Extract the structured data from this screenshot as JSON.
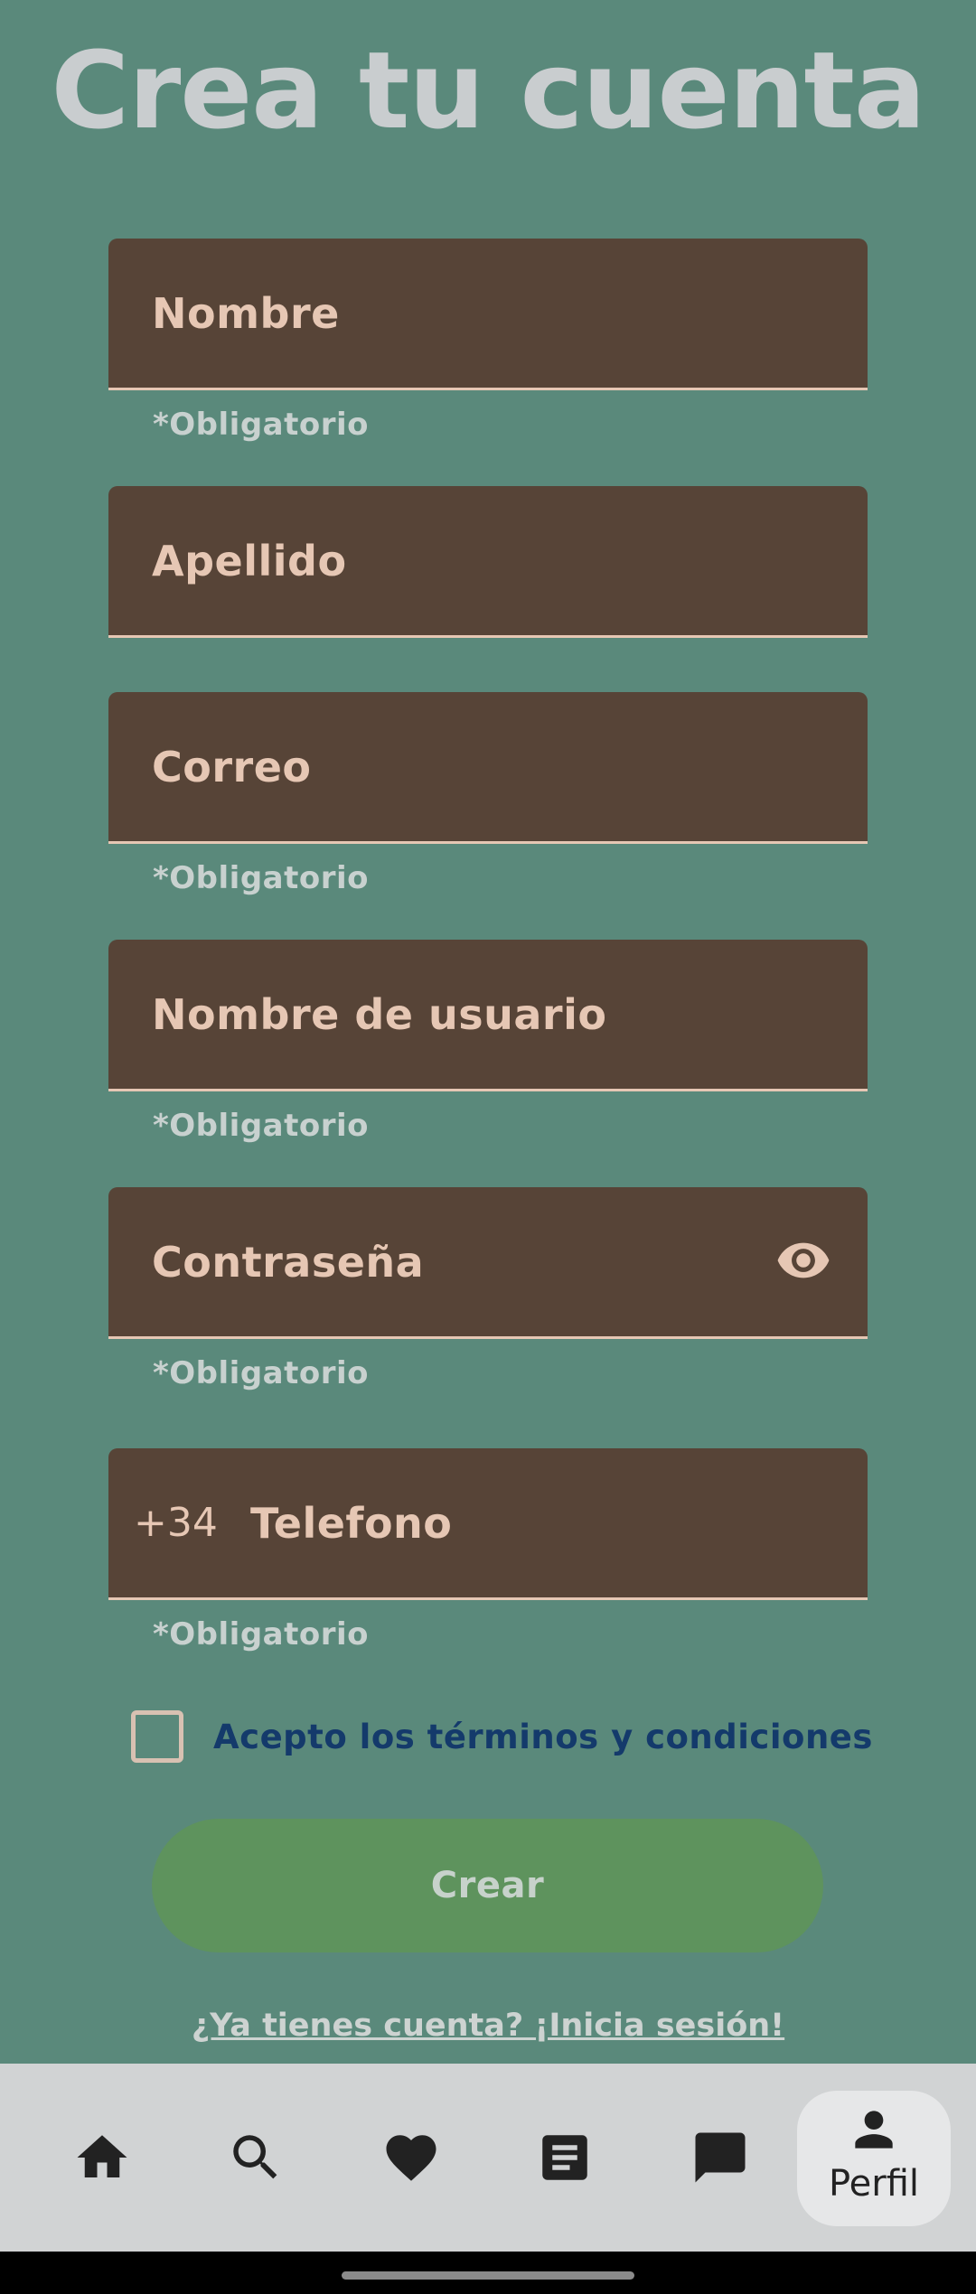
{
  "header": {
    "title": "Crea tu cuenta"
  },
  "form": {
    "nombre": {
      "label": "Nombre",
      "helper": "*Obligatorio"
    },
    "apellido": {
      "label": "Apellido"
    },
    "correo": {
      "label": "Correo",
      "helper": "*Obligatorio"
    },
    "usuario": {
      "label": "Nombre de usuario",
      "helper": "*Obligatorio"
    },
    "contrasena": {
      "label": "Contraseña",
      "helper": "*Obligatorio",
      "icon": "eye-icon"
    },
    "telefono": {
      "prefix": "+34",
      "label": "Telefono",
      "helper": "*Obligatorio"
    },
    "terms_label": "Acepto los términos y condiciones",
    "create_label": "Crear",
    "login_link": "¿Ya tienes cuenta? ¡Inicia sesión!"
  },
  "nav": {
    "items": [
      {
        "icon": "home-icon"
      },
      {
        "icon": "search-icon"
      },
      {
        "icon": "heart-icon"
      },
      {
        "icon": "document-icon"
      },
      {
        "icon": "chat-icon"
      },
      {
        "icon": "person-icon",
        "label": "Perfil",
        "active": true
      }
    ]
  },
  "colors": {
    "background": "#5a897b",
    "field": "#574437",
    "field_text": "#e6c7b4",
    "button": "#5e935d",
    "terms_text": "#143a6b",
    "navbar": "#d1d3d4"
  }
}
